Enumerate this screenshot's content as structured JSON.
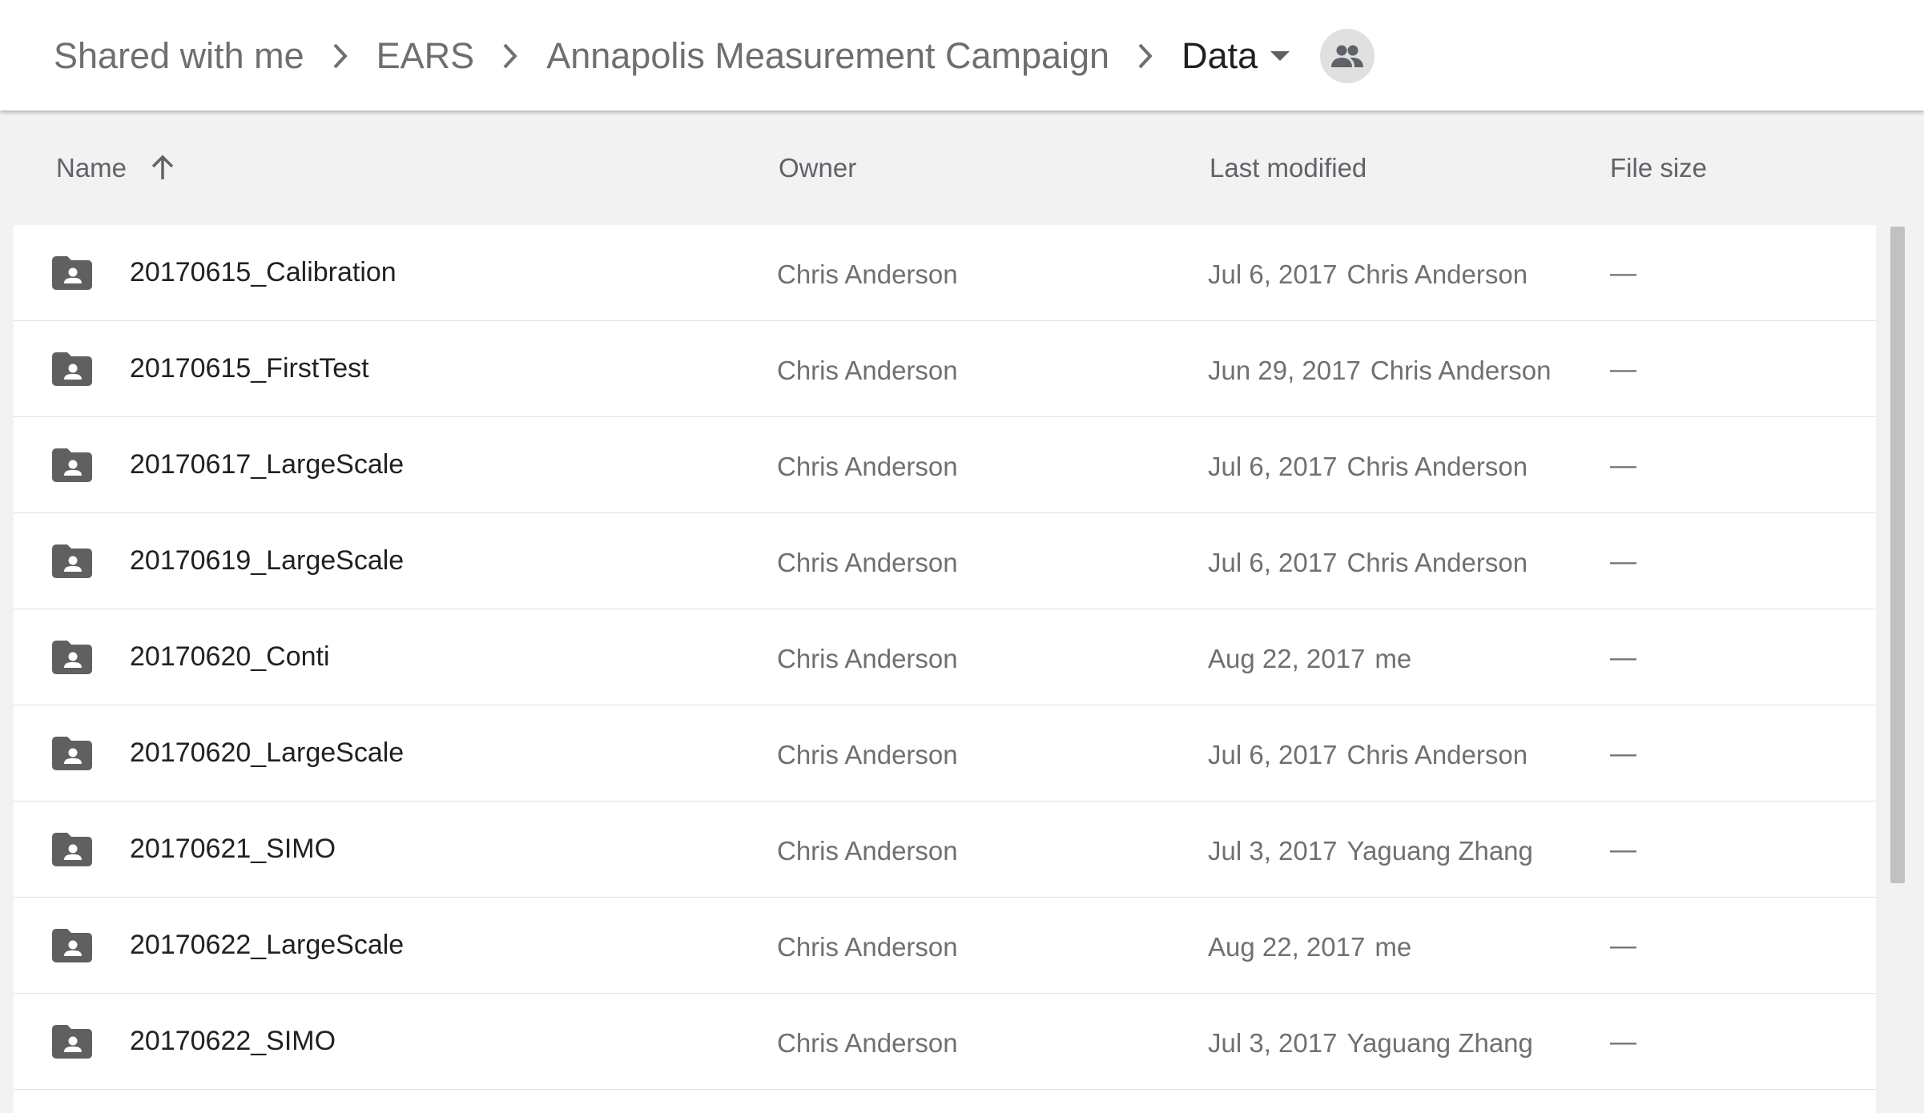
{
  "breadcrumb": {
    "items": [
      "Shared with me",
      "EARS",
      "Annapolis Measurement Campaign"
    ],
    "current": "Data"
  },
  "icons": {
    "chevron": "chevron-right-icon",
    "caret": "caret-down-icon",
    "share": "people-icon",
    "sort": "arrow-up-icon",
    "folder": "shared-folder-icon"
  },
  "columns": {
    "name": "Name",
    "owner": "Owner",
    "modified": "Last modified",
    "size": "File size"
  },
  "rows": [
    {
      "name": "20170615_Calibration",
      "owner": "Chris Anderson",
      "modified_date": "Jul 6, 2017",
      "modified_by": "Chris Anderson",
      "size": "—"
    },
    {
      "name": "20170615_FirstTest",
      "owner": "Chris Anderson",
      "modified_date": "Jun 29, 2017",
      "modified_by": "Chris Anderson",
      "size": "—"
    },
    {
      "name": "20170617_LargeScale",
      "owner": "Chris Anderson",
      "modified_date": "Jul 6, 2017",
      "modified_by": "Chris Anderson",
      "size": "—"
    },
    {
      "name": "20170619_LargeScale",
      "owner": "Chris Anderson",
      "modified_date": "Jul 6, 2017",
      "modified_by": "Chris Anderson",
      "size": "—"
    },
    {
      "name": "20170620_Conti",
      "owner": "Chris Anderson",
      "modified_date": "Aug 22, 2017",
      "modified_by": "me",
      "size": "—"
    },
    {
      "name": "20170620_LargeScale",
      "owner": "Chris Anderson",
      "modified_date": "Jul 6, 2017",
      "modified_by": "Chris Anderson",
      "size": "—"
    },
    {
      "name": "20170621_SIMO",
      "owner": "Chris Anderson",
      "modified_date": "Jul 3, 2017",
      "modified_by": "Yaguang Zhang",
      "size": "—"
    },
    {
      "name": "20170622_LargeScale",
      "owner": "Chris Anderson",
      "modified_date": "Aug 22, 2017",
      "modified_by": "me",
      "size": "—"
    },
    {
      "name": "20170622_SIMO",
      "owner": "Chris Anderson",
      "modified_date": "Jul 3, 2017",
      "modified_by": "Yaguang Zhang",
      "size": "—"
    }
  ]
}
